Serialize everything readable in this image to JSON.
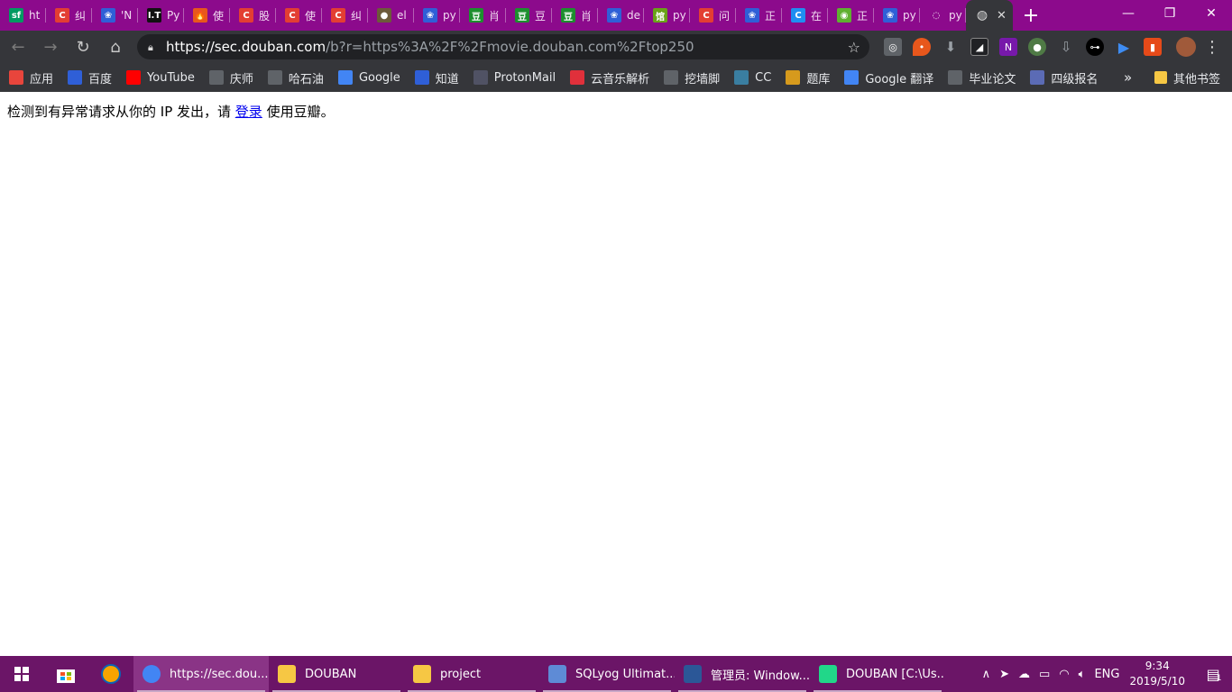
{
  "tabs": [
    {
      "title": "ht",
      "icon": "segmentfault-icon",
      "color": "#009a61",
      "glyph": "sf"
    },
    {
      "title": "纠",
      "icon": "csdn-icon",
      "color": "#e33e33",
      "glyph": "C"
    },
    {
      "title": "'N",
      "icon": "baidu-paw-icon",
      "color": "#2f5fd7",
      "glyph": "❀"
    },
    {
      "title": "Py",
      "icon": "it-icon",
      "color": "#111111",
      "glyph": "I.T"
    },
    {
      "title": "使",
      "icon": "flame-icon",
      "color": "#e8571c",
      "glyph": "🔥"
    },
    {
      "title": "股",
      "icon": "csdn-icon",
      "color": "#e33e33",
      "glyph": "C"
    },
    {
      "title": "使",
      "icon": "csdn-icon",
      "color": "#e33e33",
      "glyph": "C"
    },
    {
      "title": "纠",
      "icon": "csdn-icon",
      "color": "#e33e33",
      "glyph": "C"
    },
    {
      "title": "el",
      "icon": "user-avatar-icon",
      "color": "#6c5a3a",
      "glyph": "●"
    },
    {
      "title": "py",
      "icon": "baidu-paw-icon",
      "color": "#2f5fd7",
      "glyph": "❀"
    },
    {
      "title": "肖",
      "icon": "douban-icon",
      "color": "#1d8f2e",
      "glyph": "豆"
    },
    {
      "title": "豆",
      "icon": "douban-icon",
      "color": "#1d8f2e",
      "glyph": "豆"
    },
    {
      "title": "肖",
      "icon": "douban-icon",
      "color": "#1d8f2e",
      "glyph": "豆"
    },
    {
      "title": "de",
      "icon": "baidu-paw-icon",
      "color": "#2f5fd7",
      "glyph": "❀"
    },
    {
      "title": "py",
      "icon": "library-icon",
      "color": "#6aa318",
      "glyph": "馆"
    },
    {
      "title": "问",
      "icon": "csdn-icon",
      "color": "#e33e33",
      "glyph": "C"
    },
    {
      "title": "正",
      "icon": "baidu-paw-icon",
      "color": "#2f5fd7",
      "glyph": "❀"
    },
    {
      "title": "在",
      "icon": "cloud-c-icon",
      "color": "#1f8ef1",
      "glyph": "C"
    },
    {
      "title": "正",
      "icon": "chat-bubble-icon",
      "color": "#5fb030",
      "glyph": "◉"
    },
    {
      "title": "py",
      "icon": "baidu-paw-icon",
      "color": "#2f5fd7",
      "glyph": "❀"
    },
    {
      "title": "py",
      "icon": "loading-icon",
      "color": "#8c0a8c",
      "glyph": "◌"
    }
  ],
  "active_tab": {
    "icon": "globe-icon",
    "close_label": "✕"
  },
  "new_tab_label": "+",
  "window_controls": {
    "minimize": "—",
    "restore": "❐",
    "close": "✕"
  },
  "address_bar": {
    "url_host": "https://sec.douban.com",
    "url_rest": "/b?r=https%3A%2F%2Fmovie.douban.com%2Ftop250"
  },
  "nav": {
    "back": "←",
    "forward": "→",
    "reload": "↻",
    "home": "⌂"
  },
  "bookmarks": [
    {
      "label": "应用",
      "icon": "apps-grid-icon",
      "color": "#e8453c"
    },
    {
      "label": "百度",
      "icon": "baidu-paw-icon",
      "color": "#2f5fd7"
    },
    {
      "label": "YouTube",
      "icon": "youtube-icon",
      "color": "#ff0000"
    },
    {
      "label": "庆师",
      "icon": "globe-icon",
      "color": "#5f6368"
    },
    {
      "label": "哈石油",
      "icon": "file-icon",
      "color": "#5f6368"
    },
    {
      "label": "Google",
      "icon": "google-icon",
      "color": "#4285f4"
    },
    {
      "label": "知道",
      "icon": "baidu-paw-icon",
      "color": "#2f5fd7"
    },
    {
      "label": "ProtonMail",
      "icon": "protonmail-icon",
      "color": "#505264"
    },
    {
      "label": "云音乐解析",
      "icon": "download-icon",
      "color": "#e0303b"
    },
    {
      "label": "挖墙脚",
      "icon": "ladder-icon",
      "color": "#5f6368"
    },
    {
      "label": "CC",
      "icon": "cc-icon",
      "color": "#3a7ea1"
    },
    {
      "label": "题库",
      "icon": "quiz-icon",
      "color": "#d69a1d"
    },
    {
      "label": "Google 翻译",
      "icon": "google-translate-icon",
      "color": "#4285f4"
    },
    {
      "label": "毕业论文",
      "icon": "globe-icon",
      "color": "#5f6368"
    },
    {
      "label": "四级报名",
      "icon": "gear-badge-icon",
      "color": "#5b6bb5"
    }
  ],
  "bookmarks_more": "»",
  "other_bookmarks": "其他书签",
  "page": {
    "before_link": "检测到有异常请求从你的 IP 发出，请 ",
    "link_text": "登录",
    "after_link": " 使用豆瓣。"
  },
  "taskbar": {
    "apps": [
      {
        "label": "https://sec.dou...",
        "icon": "chrome-icon",
        "color": "#4285f4",
        "active": true
      },
      {
        "label": "DOUBAN",
        "icon": "folder-icon",
        "color": "#f6c744",
        "active": false
      },
      {
        "label": "project",
        "icon": "folder-icon",
        "color": "#f6c744",
        "active": false
      },
      {
        "label": "SQLyog Ultimat...",
        "icon": "sqlyog-dolphin-icon",
        "color": "#5e8bd6",
        "active": false
      },
      {
        "label": "管理员: Window...",
        "icon": "powershell-icon",
        "color": "#2b5797",
        "active": false
      },
      {
        "label": "DOUBAN [C:\\Us...",
        "icon": "pycharm-icon",
        "color": "#21d789",
        "active": false
      }
    ],
    "ime": "ENG",
    "time": "9:34",
    "date": "2019/5/10",
    "notification_count": "1"
  }
}
